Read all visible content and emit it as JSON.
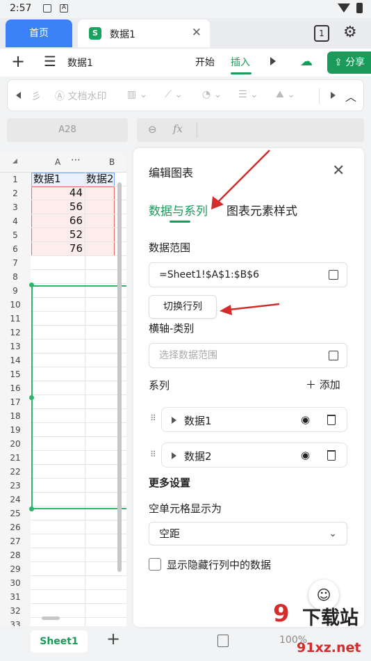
{
  "status_bar": {
    "time": "2:57",
    "badge": "A"
  },
  "tabs": {
    "home": "首页",
    "doc": "数据1",
    "doc_logo": "S",
    "count": "1"
  },
  "menu": {
    "doc_name": "数据1",
    "tab_start": "开始",
    "tab_insert": "插入",
    "share": "分享"
  },
  "toolbar": {
    "watermark": "文档水印",
    "partial_left": "彡"
  },
  "formula": {
    "cell_ref": "A28",
    "fx": "fx"
  },
  "grid": {
    "col_a": "A",
    "col_b": "B",
    "more": "⋯",
    "rows": [
      {
        "n": "1",
        "a": "数据1",
        "b": "数据2"
      },
      {
        "n": "2",
        "a": "44",
        "b": ""
      },
      {
        "n": "3",
        "a": "56",
        "b": ""
      },
      {
        "n": "4",
        "a": "66",
        "b": ""
      },
      {
        "n": "5",
        "a": "52",
        "b": ""
      },
      {
        "n": "6",
        "a": "76",
        "b": ""
      },
      {
        "n": "7",
        "a": "",
        "b": ""
      },
      {
        "n": "8",
        "a": "",
        "b": ""
      },
      {
        "n": "9",
        "a": "",
        "b": ""
      },
      {
        "n": "10",
        "a": "",
        "b": ""
      },
      {
        "n": "11",
        "a": "",
        "b": ""
      },
      {
        "n": "12",
        "a": "",
        "b": ""
      },
      {
        "n": "13",
        "a": "",
        "b": ""
      },
      {
        "n": "14",
        "a": "",
        "b": ""
      },
      {
        "n": "15",
        "a": "",
        "b": ""
      },
      {
        "n": "16",
        "a": "",
        "b": ""
      },
      {
        "n": "17",
        "a": "",
        "b": ""
      },
      {
        "n": "18",
        "a": "",
        "b": ""
      },
      {
        "n": "19",
        "a": "",
        "b": ""
      },
      {
        "n": "20",
        "a": "",
        "b": ""
      },
      {
        "n": "21",
        "a": "",
        "b": ""
      },
      {
        "n": "22",
        "a": "",
        "b": ""
      },
      {
        "n": "23",
        "a": "",
        "b": ""
      },
      {
        "n": "24",
        "a": "",
        "b": ""
      },
      {
        "n": "25",
        "a": "",
        "b": ""
      },
      {
        "n": "26",
        "a": "",
        "b": ""
      },
      {
        "n": "27",
        "a": "",
        "b": ""
      },
      {
        "n": "28",
        "a": "",
        "b": ""
      },
      {
        "n": "29",
        "a": "",
        "b": ""
      },
      {
        "n": "30",
        "a": "",
        "b": ""
      },
      {
        "n": "31",
        "a": "",
        "b": ""
      },
      {
        "n": "32",
        "a": "",
        "b": ""
      },
      {
        "n": "33",
        "a": "",
        "b": ""
      }
    ]
  },
  "bottom": {
    "sheet": "Sheet1",
    "zoom": "100%"
  },
  "panel": {
    "title": "编辑图表",
    "tab_data": "数据与系列",
    "tab_style": "图表元素样式",
    "range_label": "数据范围",
    "range_value": "=Sheet1!$A$1:$B$6",
    "swap": "切换行列",
    "xaxis_label": "横轴-类别",
    "xaxis_placeholder": "选择数据范围",
    "series_label": "系列",
    "add": "添加",
    "series": [
      "数据1",
      "数据2"
    ],
    "more": "更多设置",
    "empty_label": "空单元格显示为",
    "empty_value": "空距",
    "hidden_label": "显示隐藏行列中的数据"
  },
  "watermark": {
    "logo": "9",
    "cn": "下载站",
    "url": "91xz.net"
  },
  "colors": {
    "accent": "#1a9b5a",
    "home_tab": "#3b82f6",
    "annotation": "#d62b2b"
  }
}
